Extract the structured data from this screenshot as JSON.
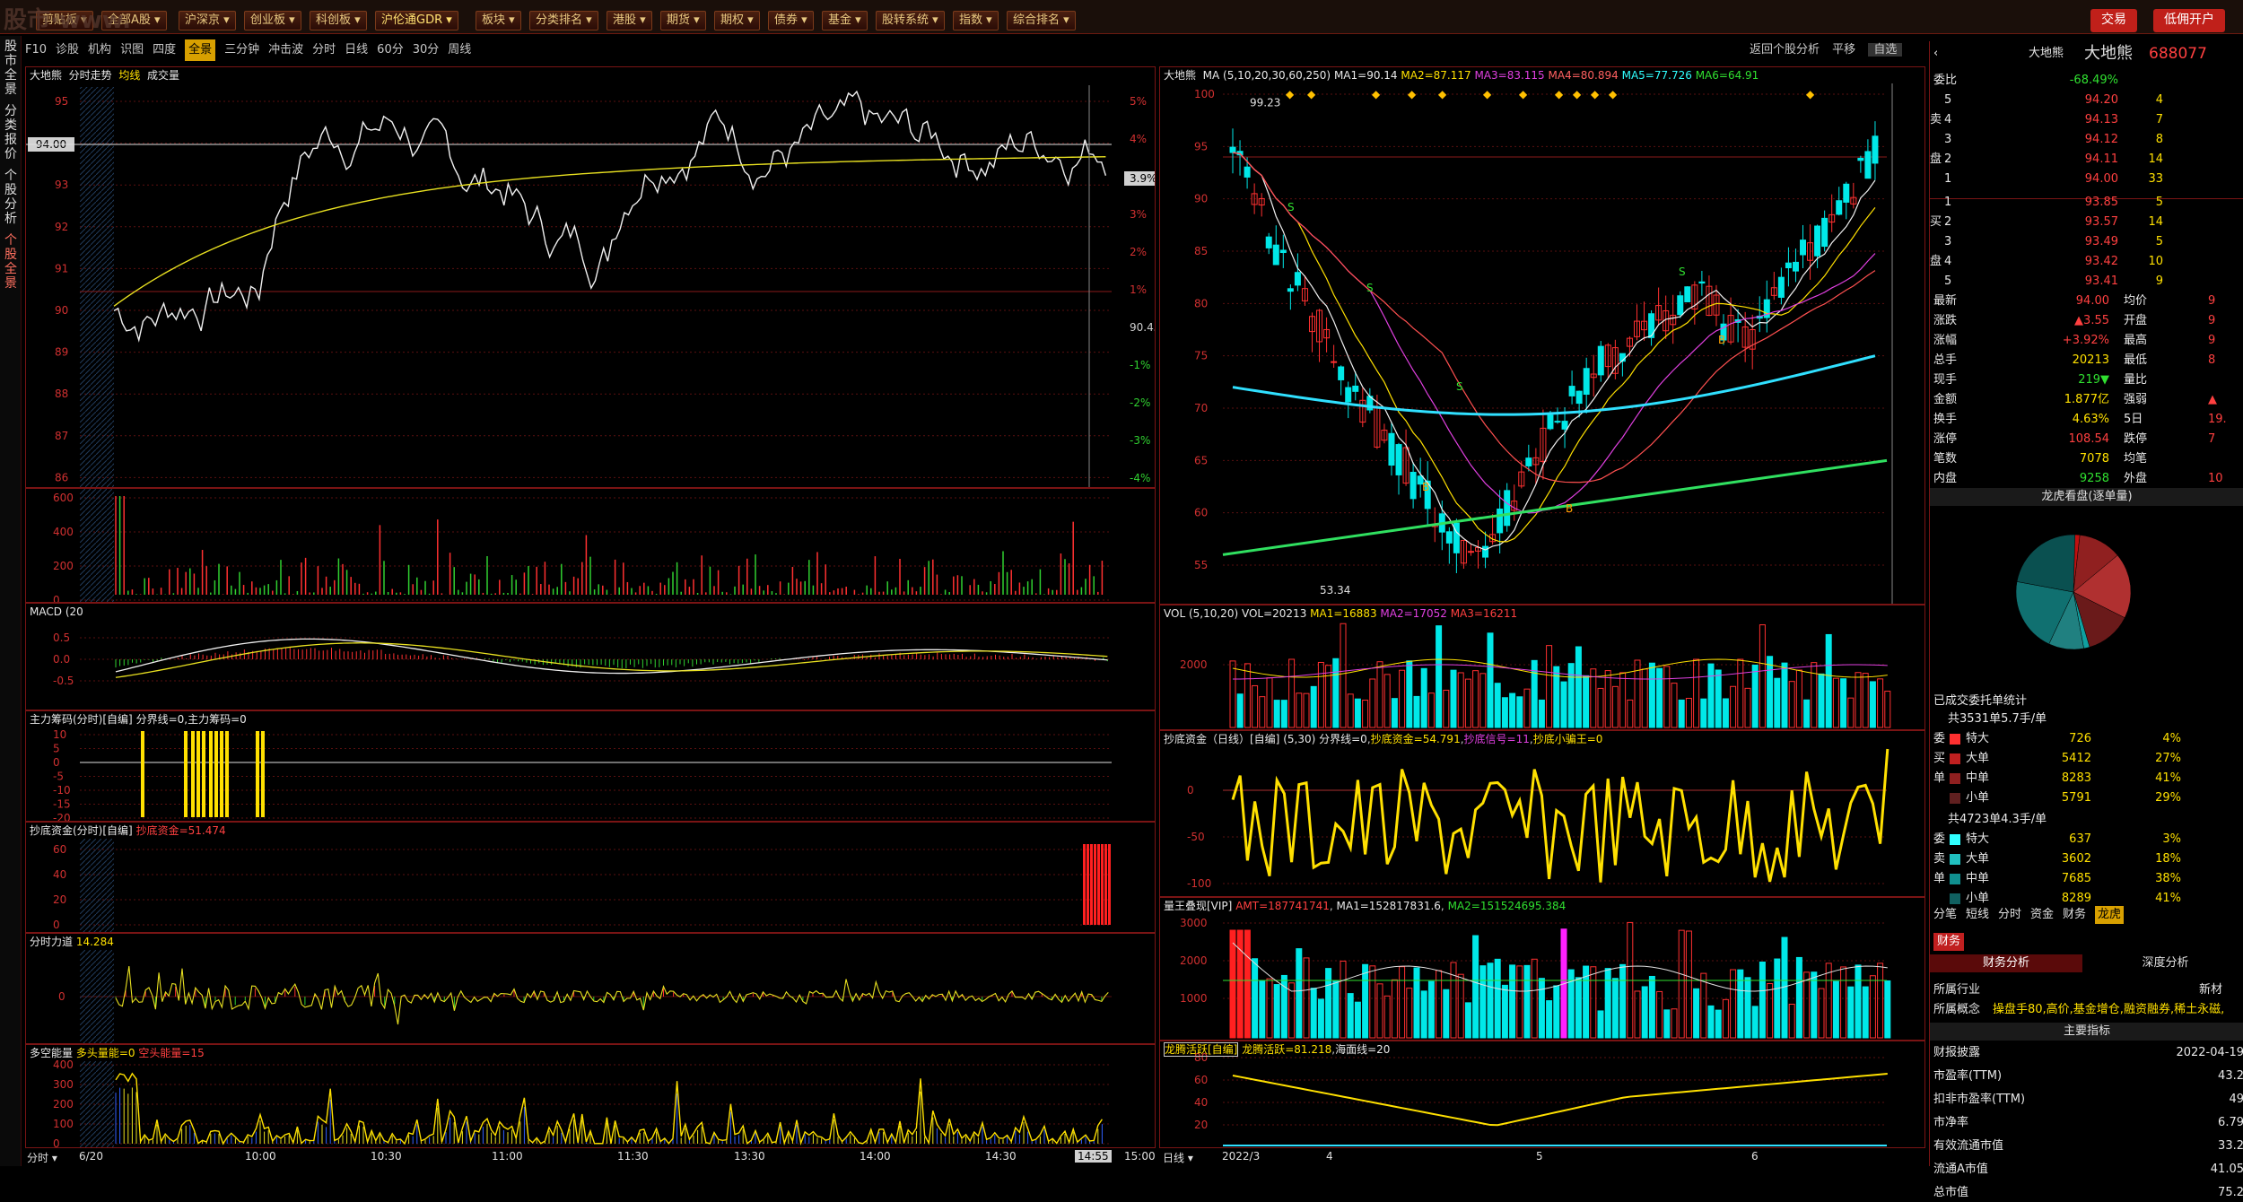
{
  "topbar": {
    "items": [
      "剪贴板",
      "全部A股",
      "沪深京",
      "创业板",
      "科创板",
      "沪伦通GDR",
      "板块",
      "分类排名",
      "港股",
      "期货",
      "期权",
      "债券",
      "基金",
      "股转系统",
      "指数",
      "综合排名"
    ],
    "watermark": "股市·www.",
    "buttons": [
      "交易",
      "低佣开户"
    ]
  },
  "leftnav": [
    "股市全景",
    "分类报价",
    "个股分析",
    "个股全景"
  ],
  "subtabs": [
    "F10",
    "诊股",
    "机构",
    "识图",
    "四度",
    "全景",
    "三分钟",
    "冲击波",
    "分时",
    "日线",
    "60分",
    "30分",
    "周线"
  ],
  "subtabs_right": [
    "返回个股分析",
    "平移",
    "自选"
  ],
  "intraday": {
    "title": "大地熊",
    "title_items": [
      "分时走势",
      "均线",
      "成交量"
    ],
    "price_ticks": [
      "95",
      "94",
      "93",
      "92",
      "91",
      "90",
      "89",
      "88",
      "87",
      "86"
    ],
    "pct_ticks": [
      "5%",
      "4%",
      "3.9%",
      "3%",
      "2%",
      "1%",
      "90.45",
      "-1%",
      "-2%",
      "-3%",
      "-4%",
      "-5%"
    ],
    "last_price_label": "94.00",
    "time_ticks": [
      "6/20",
      "10:00",
      "10:30",
      "11:00",
      "11:30",
      "13:30",
      "14:00",
      "14:30",
      "14:55",
      "15:00"
    ],
    "bottom_label": "分时",
    "vol_ticks": [
      "600",
      "400",
      "200",
      "0"
    ],
    "macd_title": "MACD",
    "macd_param": "(20",
    "macd_ticks": [
      "0.5",
      "0.0",
      "-0.5"
    ],
    "zhuli_title": "主力筹码(分时)",
    "zhuli_sub": "[自编]",
    "zhuli_formula": "分界线=0,主力筹码=0",
    "zhuli_ticks": [
      "10",
      "5",
      "0",
      "-5",
      "-10",
      "-15",
      "-20"
    ],
    "chaodi_title": "抄底资金(分时)",
    "chaodi_sub": "[自编]",
    "chaodi_formula": "抄底资金=51.474",
    "chaodi_ticks": [
      "60",
      "40",
      "20",
      "0"
    ],
    "lidao_title": "分时力道",
    "lidao_value": "14.284",
    "lidao_ticks": [
      "0"
    ],
    "duokong_title": "多空能量",
    "duokong_formula": "多头量能=0",
    "duokong_formula2": "空头能量=15",
    "duokong_ticks": [
      "400",
      "300",
      "200",
      "100",
      "0"
    ]
  },
  "kline": {
    "title": "大地熊",
    "ma_label": "MA",
    "ma_params": "(5,10,20,30,60,250)",
    "ma_values": [
      "MA1=90.14",
      "MA2=87.117",
      "MA3=83.115",
      "MA4=80.894",
      "MA5=77.726",
      "MA6=64.91"
    ],
    "price_ticks": [
      "100",
      "95",
      "90",
      "85",
      "80",
      "75",
      "70",
      "65",
      "60",
      "55"
    ],
    "high_label": "99.23",
    "low_label": "53.34",
    "vol_title": "VOL",
    "vol_params": "(5,10,20)",
    "vol_values": [
      "VOL=20213",
      "MA1=16883",
      "MA2=17052",
      "MA3=16211"
    ],
    "vol_ticks": [
      "2000"
    ],
    "chaodi_title": "抄底资金（日线）[自编]",
    "chaodi_params": "(5,30)",
    "chaodi_values": [
      "分界线=0",
      "抄底资金=54.791",
      "抄底信号=11",
      "抄底小骗王=0"
    ],
    "chaodi_ticks": [
      "0",
      "-50",
      "-100"
    ],
    "liangwang_title": "量王叠现[VIP]",
    "liangwang_values": [
      "AMT=187741741",
      "MA1=152817831.6",
      "MA2=151524695.384"
    ],
    "liangwang_ticks": [
      "3000",
      "2000",
      "1000"
    ],
    "longteng_title": "龙腾活跃[自编]",
    "longteng_values": [
      "龙腾活跃=81.218",
      "海面线=20"
    ],
    "longteng_ticks": [
      "80",
      "60",
      "40",
      "20"
    ],
    "date_ticks": [
      "2022/3",
      "4",
      "5",
      "6"
    ],
    "bottom_label": "日线"
  },
  "quote": {
    "name": "大地熊",
    "code": "688077",
    "webi_label": "委比",
    "webi_value": "-68.49%",
    "asks": [
      [
        "5",
        "94.20",
        "4"
      ],
      [
        "4",
        "94.13",
        "7"
      ],
      [
        "3",
        "94.12",
        "8"
      ],
      [
        "2",
        "94.11",
        "14"
      ],
      [
        "1",
        "94.00",
        "33"
      ]
    ],
    "bids": [
      [
        "1",
        "93.85",
        "5"
      ],
      [
        "2",
        "93.57",
        "14"
      ],
      [
        "3",
        "93.49",
        "5"
      ],
      [
        "4",
        "93.42",
        "10"
      ],
      [
        "5",
        "93.41",
        "9"
      ]
    ],
    "side_sell": [
      "卖",
      "盘"
    ],
    "side_buy": [
      "买",
      "盘"
    ],
    "stats": [
      [
        "最新",
        "94.00",
        "均价",
        "9"
      ],
      [
        "涨跌",
        "▲3.55",
        "开盘",
        "9"
      ],
      [
        "涨幅",
        "+3.92%",
        "最高",
        "9"
      ],
      [
        "总手",
        "20213",
        "最低",
        "8"
      ],
      [
        "现手",
        "219▼",
        "量比",
        ""
      ],
      [
        "金额",
        "1.877亿",
        "强弱",
        "▲"
      ],
      [
        "换手",
        "4.63%",
        "5日",
        "19."
      ],
      [
        "涨停",
        "108.54",
        "跌停",
        "7"
      ],
      [
        "笔数",
        "7078",
        "均笔",
        ""
      ],
      [
        "内盘",
        "9258",
        "外盘",
        "10"
      ]
    ],
    "pie_title": "龙虎看盘(逐单量)",
    "order_title": "已成交委托单统计",
    "buy_total": "共3531单5.7手/单",
    "buy_rows": [
      [
        "委",
        "特大",
        "726",
        "4%"
      ],
      [
        "买",
        "大单",
        "5412",
        "27%"
      ],
      [
        "单",
        "中单",
        "8283",
        "41%"
      ],
      [
        "",
        "小单",
        "5791",
        "29%"
      ]
    ],
    "sell_total": "共4723单4.3手/单",
    "sell_rows": [
      [
        "委",
        "特大",
        "637",
        "3%"
      ],
      [
        "卖",
        "大单",
        "3602",
        "18%"
      ],
      [
        "单",
        "中单",
        "7685",
        "38%"
      ],
      [
        "",
        "小单",
        "8289",
        "41%"
      ]
    ],
    "tabs": [
      "分笔",
      "短线",
      "分时",
      "资金",
      "财务",
      "龙虎"
    ],
    "fin_tab": "财务",
    "fin_sub": [
      "财务分析",
      "深度分析"
    ],
    "industry_label": "所属行业",
    "industry_value": "新材",
    "concept_label": "所属概念",
    "concept_value": "操盘手80,高价,基金增仓,融资融券,稀土永磁,",
    "main_index": "主要指标",
    "fin_rows": [
      [
        "财报披露",
        "2022-04-19"
      ],
      [
        "市盈率(TTM)",
        "43.2"
      ],
      [
        "扣非市盈率(TTM)",
        "49"
      ],
      [
        "市净率",
        "6.79"
      ],
      [
        "有效流通市值",
        "33.2"
      ],
      [
        "流通A市值",
        "41.05"
      ],
      [
        "总市值",
        "75.2"
      ]
    ]
  },
  "colors": {
    "up": "#ff3030",
    "down": "#00e8e8",
    "yellow": "#ffe000",
    "grid": "#7a1414"
  }
}
